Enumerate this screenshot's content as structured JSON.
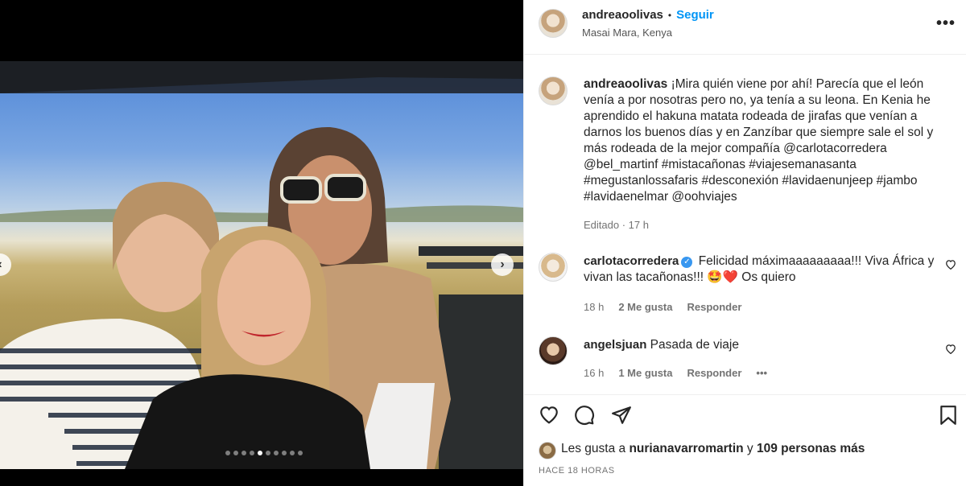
{
  "post": {
    "author": "andreaoolivas",
    "follow_label": "Seguir",
    "separator": "•",
    "location": "Masai Mara, Kenya",
    "more_label": "•••"
  },
  "media": {
    "prev_label": "‹",
    "next_label": "›",
    "slide_count": 10,
    "active_slide": 5
  },
  "caption": {
    "author": "andreaoolivas",
    "text": "¡Mira quién viene por ahí! Parecía que el león venía a por nosotras pero no, ya tenía a su leona. En Kenia he aprendido el hakuna matata rodeada de jirafas que venían a darnos los buenos días y en Zanzíbar que siempre sale el sol y más rodeada de la mejor compañía @carlotacorredera @bel_martinf #mistacañonas #viajesemanasanta #megustanlossafaris #desconexión #lavidaenunjeep #jambo #lavidaenelmar @oohviajes",
    "edited": "Editado · 17 h"
  },
  "comments": [
    {
      "author": "carlotacorredera",
      "verified_icon": "✓",
      "text": "Felicidad máximaaaaaaaaa!!! Viva África y vivan las tacañonas!!! 🤩❤️ Os quiero",
      "time": "18 h",
      "likes": "2 Me gusta",
      "reply": "Responder"
    },
    {
      "author": "angelsjuan",
      "text": "Pasada de viaje",
      "time": "16 h",
      "likes": "1 Me gusta",
      "reply": "Responder",
      "more": "•••"
    }
  ],
  "likes": {
    "prefix": "Les gusta a",
    "user": "nurianavarromartin",
    "conj": "y",
    "others": "109 personas más"
  },
  "timestamp": "HACE 18 HORAS",
  "colors": {
    "link": "#0095f6",
    "verified": "#3897f0",
    "meta": "#737373"
  },
  "icons": [
    "heart-icon",
    "comment-icon",
    "share-icon",
    "bookmark-icon",
    "more-icon",
    "chevron-right-icon"
  ]
}
